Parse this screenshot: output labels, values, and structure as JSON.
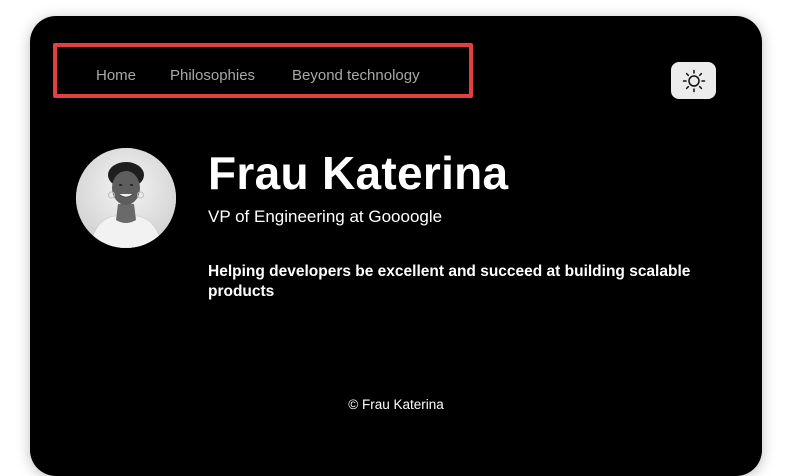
{
  "nav": {
    "items": [
      {
        "label": "Home"
      },
      {
        "label": "Philosophies"
      },
      {
        "label": "Beyond technology"
      }
    ],
    "highlight_color": "#e0403f"
  },
  "theme_toggle": {
    "icon": "sun-icon"
  },
  "profile": {
    "name": "Frau Katerina",
    "role": "VP of Engineering at Goooogle",
    "tagline": "Helping developers be excellent and succeed at building scalable products",
    "avatar": "portrait-photo"
  },
  "footer": {
    "copyright": "© Frau Katerina"
  },
  "colors": {
    "background": "#000000",
    "text": "#ffffff",
    "nav_text": "#a8a8a8"
  }
}
